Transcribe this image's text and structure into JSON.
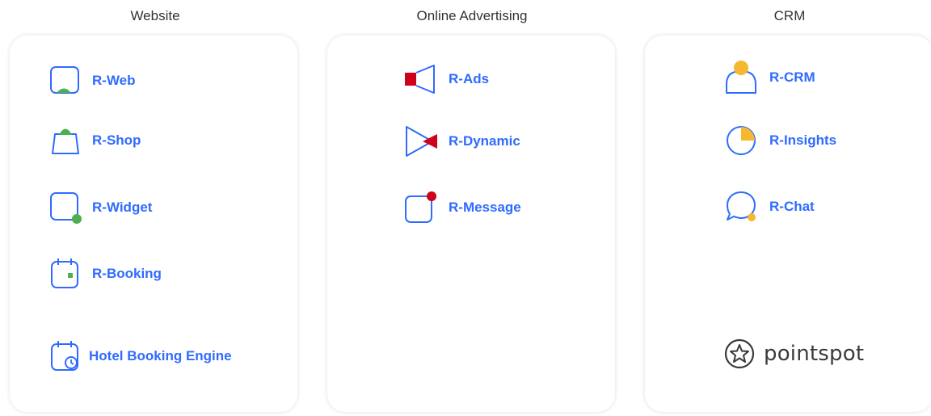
{
  "columns": {
    "website": {
      "title": "Website",
      "items": [
        "R-Web",
        "R-Shop",
        "R-Widget",
        "R-Booking",
        "Hotel Booking Engine"
      ]
    },
    "online_advertising": {
      "title": "Online Advertising",
      "items": [
        "R-Ads",
        "R-Dynamic",
        "R-Message"
      ]
    },
    "crm": {
      "title": "CRM",
      "items": [
        "R-CRM",
        "R-Insights",
        "R-Chat"
      ],
      "partner_logo": "pointspot"
    }
  },
  "colors": {
    "link_blue": "#2f6bff",
    "icon_outline": "#2f6bff",
    "website_accent": "#4caf50",
    "advertising_accent": "#d0021b",
    "crm_accent": "#f5b82e",
    "logo_gray": "#3a3a3a"
  },
  "icons": {
    "website": [
      "monitor-icon",
      "shopping-bag-icon",
      "widget-icon",
      "calendar-icon",
      "calendar-clock-icon"
    ],
    "online_advertising": [
      "megaphone-icon",
      "play-icon",
      "message-icon"
    ],
    "crm": [
      "user-icon",
      "pie-chart-icon",
      "chat-bubble-icon",
      "star-badge-icon"
    ]
  }
}
